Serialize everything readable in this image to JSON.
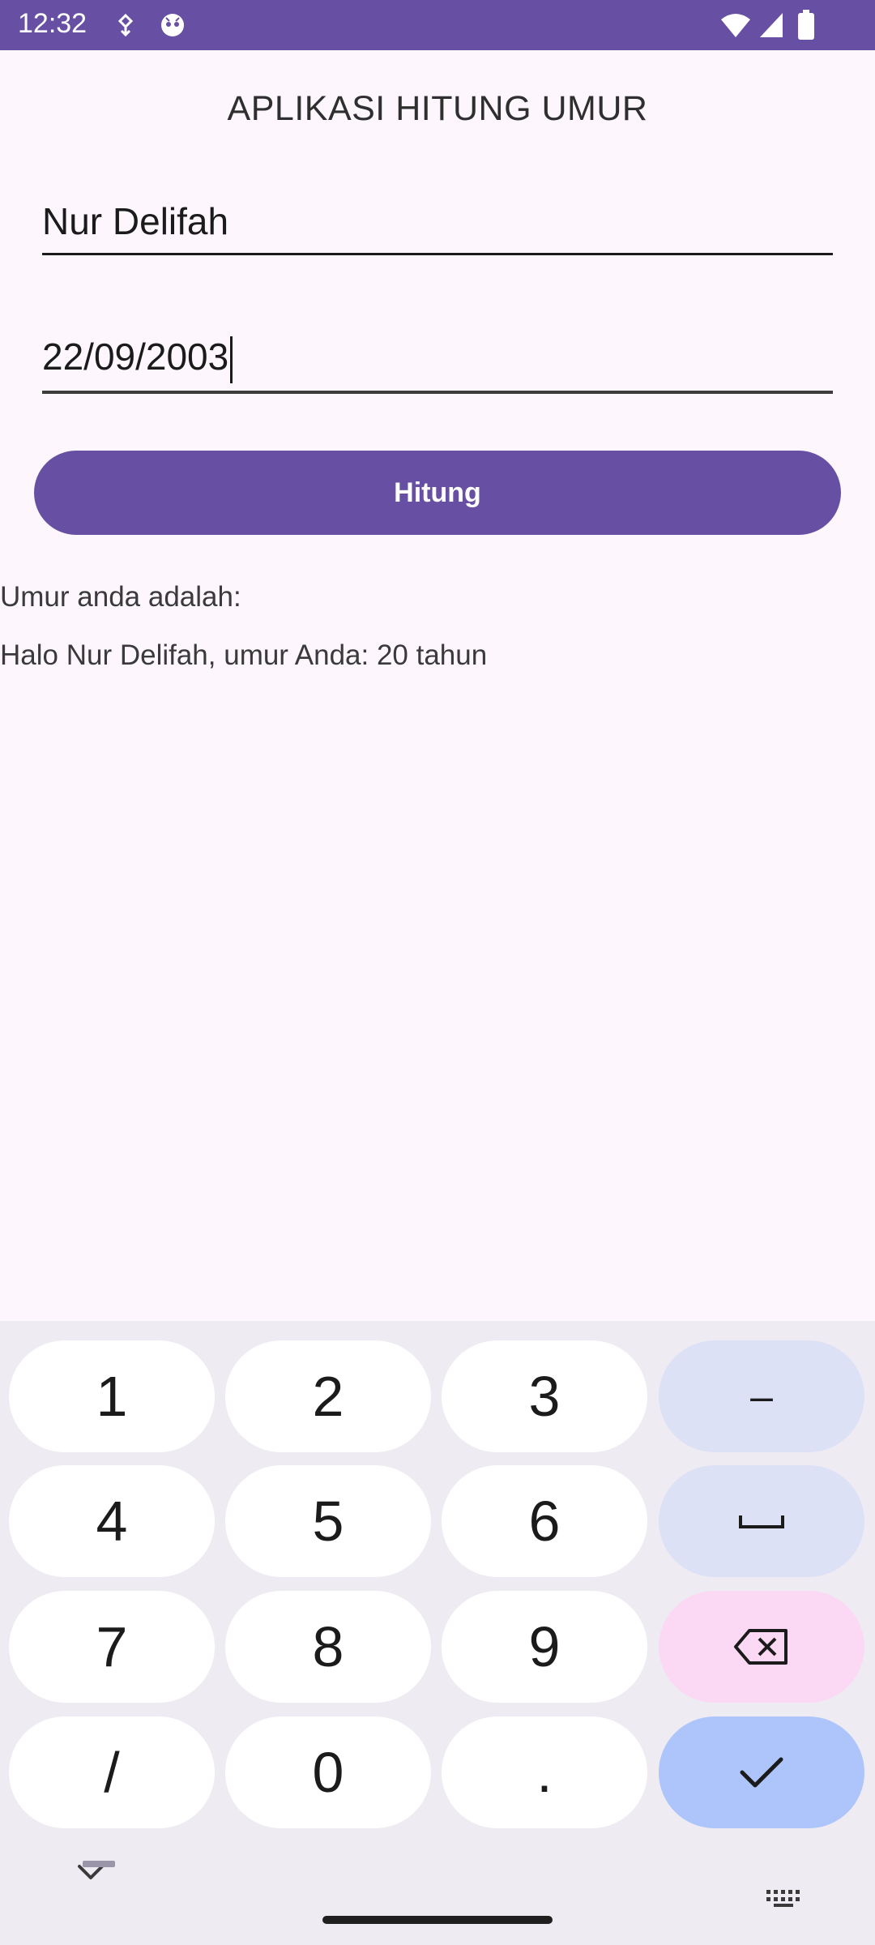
{
  "status": {
    "time": "12:32"
  },
  "app": {
    "title": "APLIKASI HITUNG UMUR",
    "name_value": "Nur Delifah",
    "date_value": "22/09/2003",
    "button_label": "Hitung",
    "result_label": "Umur anda adalah:",
    "result_text": "Halo Nur Delifah, umur Anda: 20 tahun"
  },
  "keyboard": {
    "keys": [
      {
        "label": "1"
      },
      {
        "label": "2"
      },
      {
        "label": "3"
      },
      {
        "label": "–"
      },
      {
        "label": "4"
      },
      {
        "label": "5"
      },
      {
        "label": "6"
      },
      {
        "label": "space",
        "icon": "space-icon"
      },
      {
        "label": "7"
      },
      {
        "label": "8"
      },
      {
        "label": "9"
      },
      {
        "label": "backspace",
        "icon": "backspace-icon"
      },
      {
        "label": "/"
      },
      {
        "label": "0"
      },
      {
        "label": "."
      },
      {
        "label": "done",
        "icon": "check-icon"
      }
    ]
  },
  "colors": {
    "primary": "#6750a4",
    "background": "#fdf7fd",
    "keyboard_bg": "#eeebf3",
    "key_side": "#dde1f6",
    "key_delete": "#fbd8f3",
    "key_enter": "#adc5fb"
  }
}
